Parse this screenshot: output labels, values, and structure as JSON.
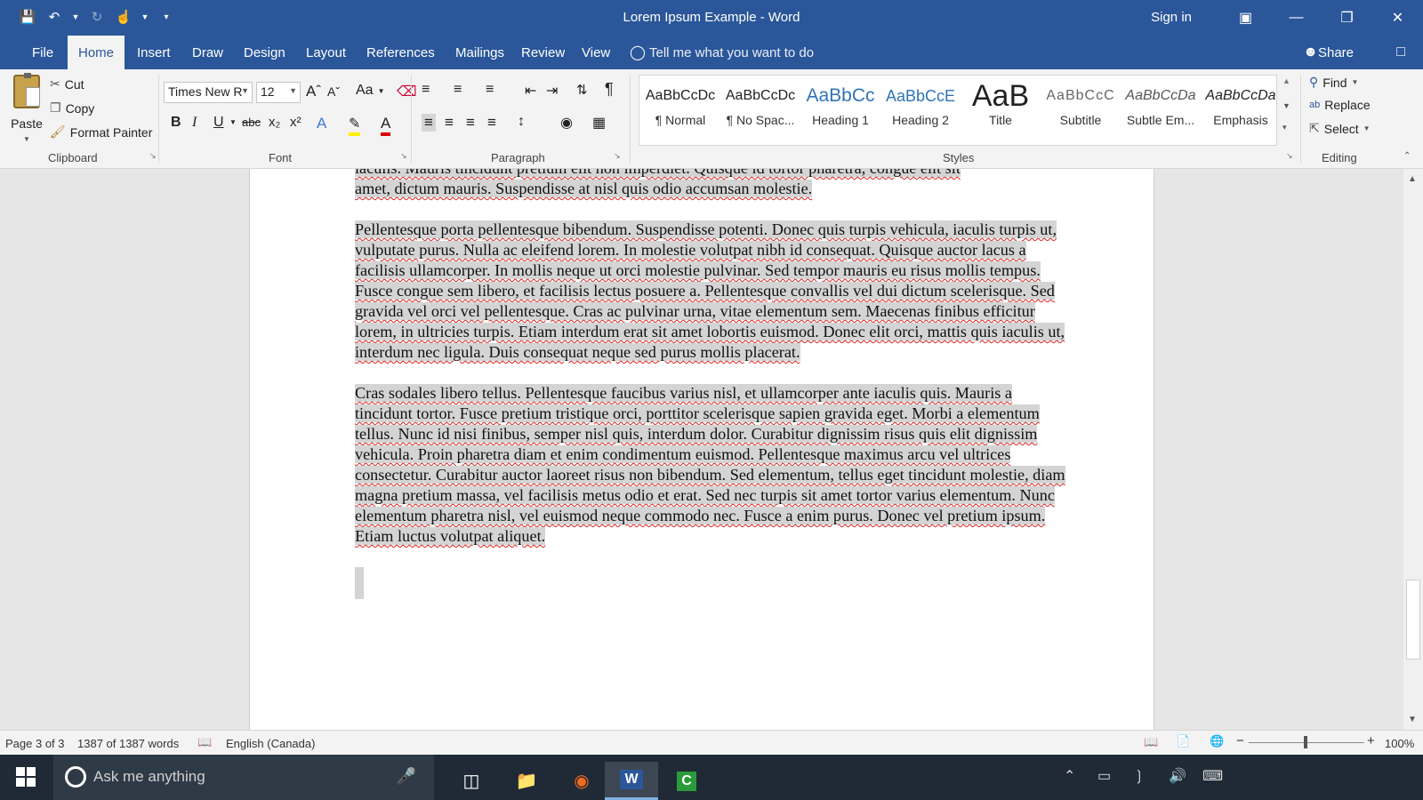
{
  "window": {
    "title": "Lorem Ipsum Example - Word",
    "sign_in": "Sign in"
  },
  "tabs": {
    "file": "File",
    "home": "Home",
    "insert": "Insert",
    "draw": "Draw",
    "design": "Design",
    "layout": "Layout",
    "references": "References",
    "mailings": "Mailings",
    "review": "Review",
    "view": "View",
    "tell_me": "Tell me what you want to do",
    "share": "Share"
  },
  "clipboard": {
    "paste": "Paste",
    "cut": "Cut",
    "copy": "Copy",
    "format_painter": "Format Painter",
    "label": "Clipboard"
  },
  "font": {
    "family": "Times New R",
    "size": "12",
    "change_case": "Aa",
    "label": "Font"
  },
  "paragraph": {
    "label": "Paragraph"
  },
  "styles": {
    "label": "Styles",
    "items": [
      {
        "sample": "AaBbCcDc",
        "name": "¶ Normal"
      },
      {
        "sample": "AaBbCcDc",
        "name": "¶ No Spac..."
      },
      {
        "sample": "AaBbCc",
        "name": "Heading 1"
      },
      {
        "sample": "AaBbCcE",
        "name": "Heading 2"
      },
      {
        "sample": "AaB",
        "name": "Title"
      },
      {
        "sample": "AaBbCcC",
        "name": "Subtitle"
      },
      {
        "sample": "AaBbCcDa",
        "name": "Subtle Em..."
      },
      {
        "sample": "AaBbCcDa",
        "name": "Emphasis"
      }
    ]
  },
  "editing": {
    "find": "Find",
    "replace": "Replace",
    "select": "Select",
    "label": "Editing"
  },
  "document": {
    "line_top_cut": "iaculis. Mauris tincidunt pretium elit non imperdiet. Quisque id tortor pharetra, congue elit sit",
    "para0_end": "amet, dictum mauris. Suspendisse at nisl quis odio accumsan molestie.",
    "para1": "Pellentesque porta pellentesque bibendum. Suspendisse potenti. Donec quis turpis vehicula, iaculis turpis ut, vulputate purus. Nulla ac eleifend lorem. In molestie volutpat nibh id consequat. Quisque auctor lacus a facilisis ullamcorper. In mollis neque ut orci molestie pulvinar. Sed tempor mauris eu risus mollis tempus. Fusce congue sem libero, et facilisis lectus posuere a. Pellentesque convallis vel dui dictum scelerisque. Sed gravida vel orci vel pellentesque. Cras ac pulvinar urna, vitae elementum sem. Maecenas finibus efficitur lorem, in ultricies turpis. Etiam interdum erat sit amet lobortis euismod. Donec elit orci, mattis quis iaculis ut, interdum nec ligula. Duis consequat neque sed purus mollis placerat.",
    "para2": "Cras sodales libero tellus. Pellentesque faucibus varius nisl, et ullamcorper ante iaculis quis. Mauris a tincidunt tortor. Fusce pretium tristique orci, porttitor scelerisque sapien gravida eget. Morbi a elementum tellus. Nunc id nisi finibus, semper nisl quis, interdum dolor. Curabitur dignissim risus quis elit dignissim vehicula. Proin pharetra diam et enim condimentum euismod. Pellentesque maximus arcu vel ultrices consectetur. Curabitur auctor laoreet risus non bibendum. Sed elementum, tellus eget tincidunt molestie, diam magna pretium massa, vel facilisis metus odio et erat. Sed nec turpis sit amet tortor varius elementum. Nunc elementum pharetra nisl, vel euismod neque commodo nec. Fusce a enim purus. Donec vel pretium ipsum. Etiam luctus volutpat aliquet."
  },
  "status": {
    "page": "Page 3 of 3",
    "words": "1387 of 1387 words",
    "language": "English (Canada)",
    "zoom": "100%"
  },
  "taskbar": {
    "search_placeholder": "Ask me anything"
  },
  "colors": {
    "accent": "#2b579a",
    "selection": "#d4d4d4"
  }
}
